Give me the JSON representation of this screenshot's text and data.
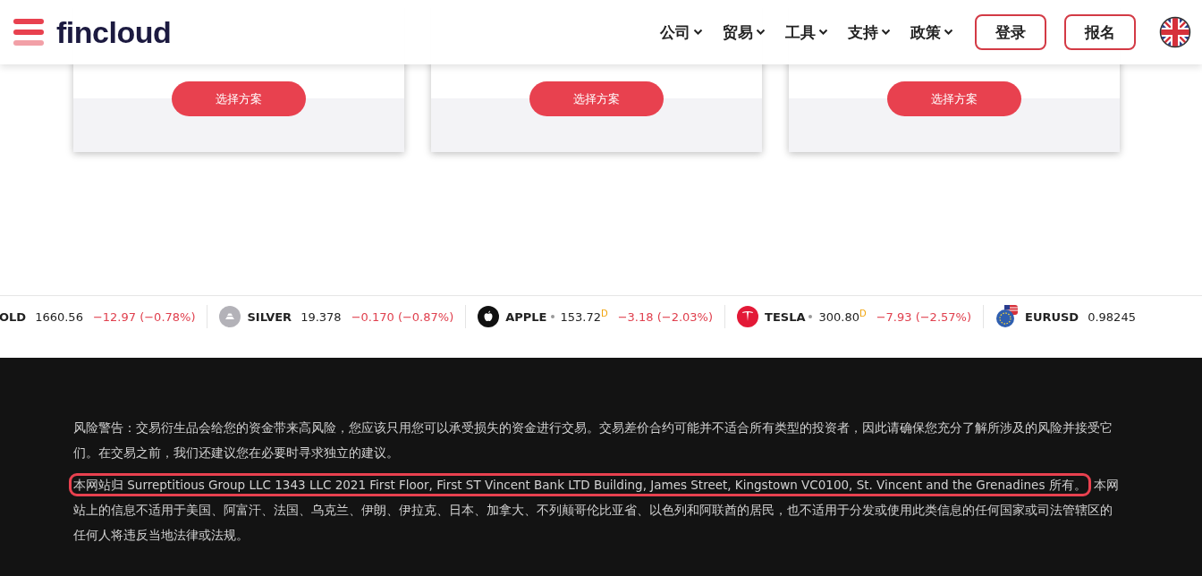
{
  "header": {
    "logo": "fincloud",
    "nav": [
      {
        "label": "公司"
      },
      {
        "label": "贸易"
      },
      {
        "label": "工具"
      },
      {
        "label": "支持"
      },
      {
        "label": "政策"
      }
    ],
    "buttons": [
      "登录",
      "报名"
    ]
  },
  "plans": [
    {
      "button": "选择方案"
    },
    {
      "button": "选择方案"
    },
    {
      "button": "选择方案"
    }
  ],
  "ticker": [
    {
      "kind": "none",
      "symbol": "OLD",
      "price": "1660.56",
      "change": "−12.97 (−0.78%)",
      "delayed": false
    },
    {
      "kind": "silver",
      "symbol": "SILVER",
      "price": "19.378",
      "change": "−0.170 (−0.87%)",
      "delayed": false
    },
    {
      "kind": "apple",
      "symbol": "APPLE",
      "price": "153.72",
      "delay_mark": "D",
      "change": "−3.18 (−2.03%)",
      "delayed": true
    },
    {
      "kind": "tesla",
      "symbol": "TESLA",
      "price": "300.80",
      "delay_mark": "D",
      "change": "−7.93 (−2.57%)",
      "delayed": true
    },
    {
      "kind": "flag",
      "symbol": "EURUSD",
      "price": "0.98245",
      "delayed": false
    }
  ],
  "footer": {
    "risk_warning": "风险警告：交易衍生品会给您的资金带来高风险，您应该只用您可以承受损失的资金进行交易。交易差价合约可能并不适合所有类型的投资者，因此请确保您充分了解所涉及的风险并接受它们。在交易之前，我们还建议您在必要时寻求独立的建议。",
    "ownership_highlighted": "本网站归 Surreptitious Group LLC 1343 LLC 2021 First Floor, First ST Vincent Bank LTD Building, James Street, Kingstown VC0100, St. Vincent and the Grenadines 所有。",
    "ownership_rest": "本网站上的信息不适用于美国、阿富汗、法国、乌克兰、伊朗、伊拉克、日本、加拿大、不列颠哥伦比亚省、以色列和阿联酋的居民，也不适用于分发或使用此类信息的任何国家或司法管辖区的任何人将违反当地法律或法规。"
  }
}
